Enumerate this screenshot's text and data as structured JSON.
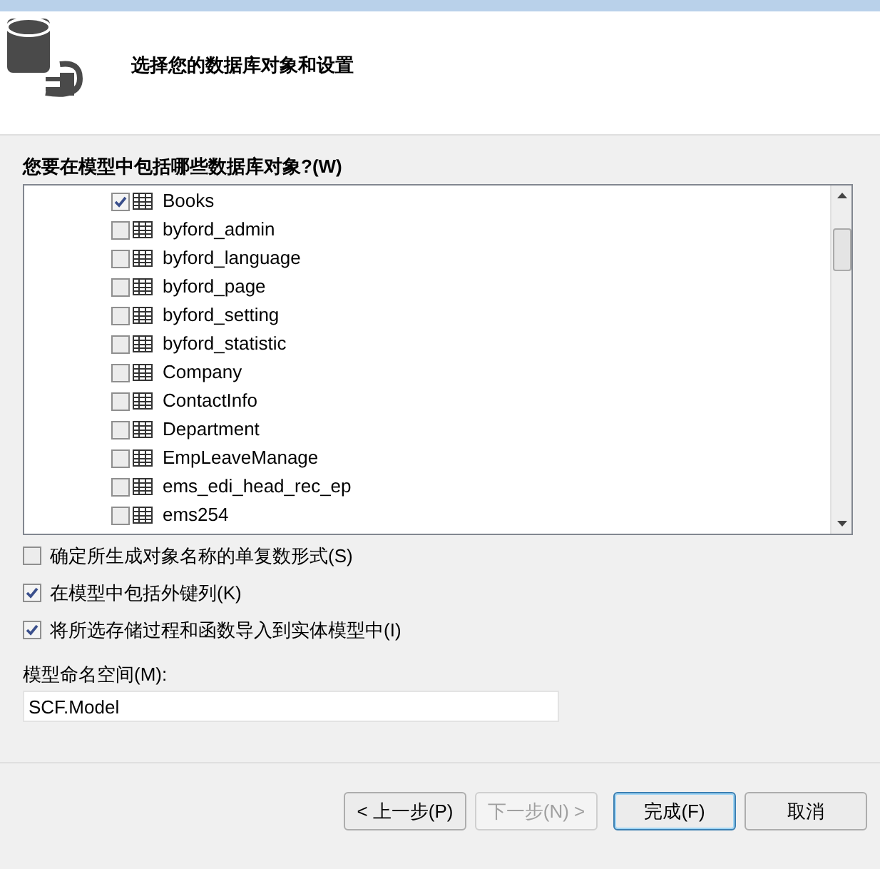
{
  "header": {
    "title": "选择您的数据库对象和设置"
  },
  "objects": {
    "label": "您要在模型中包括哪些数据库对象?(W)",
    "items": [
      {
        "name": "Books",
        "checked": true
      },
      {
        "name": "byford_admin",
        "checked": false
      },
      {
        "name": "byford_language",
        "checked": false
      },
      {
        "name": "byford_page",
        "checked": false
      },
      {
        "name": "byford_setting",
        "checked": false
      },
      {
        "name": "byford_statistic",
        "checked": false
      },
      {
        "name": "Company",
        "checked": false
      },
      {
        "name": "ContactInfo",
        "checked": false
      },
      {
        "name": "Department",
        "checked": false
      },
      {
        "name": "EmpLeaveManage",
        "checked": false
      },
      {
        "name": "ems_edi_head_rec_ep",
        "checked": false
      },
      {
        "name": "ems254",
        "checked": false
      }
    ]
  },
  "options": [
    {
      "label": "确定所生成对象名称的单复数形式(S)",
      "checked": false
    },
    {
      "label": "在模型中包括外键列(K)",
      "checked": true
    },
    {
      "label": "将所选存储过程和函数导入到实体模型中(I)",
      "checked": true
    }
  ],
  "namespace": {
    "label": "模型命名空间(M):",
    "value": "SCF.Model"
  },
  "buttons": [
    {
      "label": "< 上一步(P)",
      "disabled": false,
      "focused": false
    },
    {
      "label": "下一步(N) >",
      "disabled": true,
      "focused": false
    },
    {
      "label": "完成(F)",
      "disabled": false,
      "focused": true
    },
    {
      "label": "取消",
      "disabled": false,
      "focused": false
    }
  ]
}
